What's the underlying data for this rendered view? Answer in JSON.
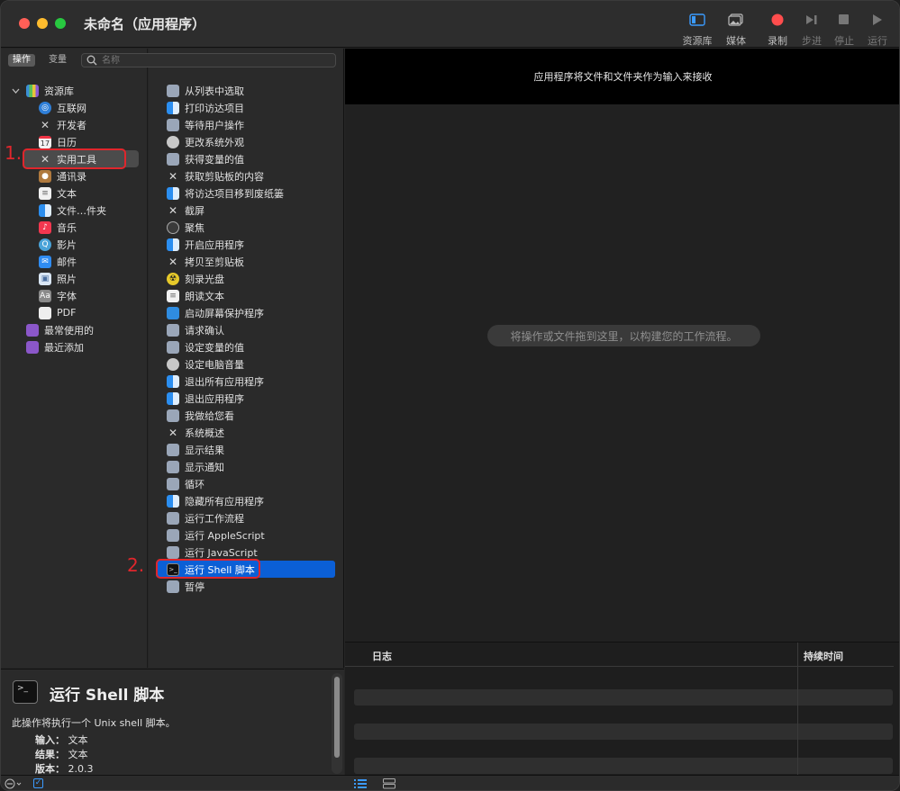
{
  "window": {
    "title": "未命名（应用程序）"
  },
  "toolbar": {
    "library_label": "资源库",
    "media_label": "媒体",
    "record_label": "录制",
    "step_label": "步进",
    "stop_label": "停止",
    "run_label": "运行",
    "colors": {
      "accent": "#3b9bff",
      "record": "#ff4d4d"
    }
  },
  "tabs": {
    "actions": "操作",
    "variables": "变量"
  },
  "search": {
    "placeholder": "名称",
    "value": ""
  },
  "library": {
    "root": "资源库",
    "items": [
      {
        "label": "互联网",
        "icon": "globe-icon"
      },
      {
        "label": "开发者",
        "icon": "tools-icon"
      },
      {
        "label": "日历",
        "icon": "calendar-icon"
      },
      {
        "label": "实用工具",
        "icon": "tools-icon"
      },
      {
        "label": "通讯录",
        "icon": "contacts-icon"
      },
      {
        "label": "文本",
        "icon": "text-icon"
      },
      {
        "label": "文件…件夹",
        "icon": "finder-icon"
      },
      {
        "label": "音乐",
        "icon": "music-icon"
      },
      {
        "label": "影片",
        "icon": "movie-icon"
      },
      {
        "label": "邮件",
        "icon": "mail-icon"
      },
      {
        "label": "照片",
        "icon": "photos-icon"
      },
      {
        "label": "字体",
        "icon": "font-icon"
      },
      {
        "label": "PDF",
        "icon": "pdf-icon"
      }
    ],
    "smart_groups": [
      {
        "label": "最常使用的",
        "icon": "smart-folder-icon"
      },
      {
        "label": "最近添加",
        "icon": "smart-folder-icon"
      }
    ]
  },
  "actions": [
    {
      "label": "从列表中选取",
      "icon": "automator-icon"
    },
    {
      "label": "打印访达项目",
      "icon": "finder-icon"
    },
    {
      "label": "等待用户操作",
      "icon": "automator-icon"
    },
    {
      "label": "更改系统外观",
      "icon": "system-icon"
    },
    {
      "label": "获得变量的值",
      "icon": "automator-icon"
    },
    {
      "label": "获取剪贴板的内容",
      "icon": "tools-icon"
    },
    {
      "label": "将访达项目移到废纸篓",
      "icon": "finder-icon"
    },
    {
      "label": "截屏",
      "icon": "tools-icon"
    },
    {
      "label": "聚焦",
      "icon": "spotlight-icon"
    },
    {
      "label": "开启应用程序",
      "icon": "finder-icon"
    },
    {
      "label": "拷贝至剪贴板",
      "icon": "tools-icon"
    },
    {
      "label": "刻录光盘",
      "icon": "burn-icon"
    },
    {
      "label": "朗读文本",
      "icon": "text-icon"
    },
    {
      "label": "启动屏幕保护程序",
      "icon": "screensaver-icon"
    },
    {
      "label": "请求确认",
      "icon": "automator-icon"
    },
    {
      "label": "设定变量的值",
      "icon": "automator-icon"
    },
    {
      "label": "设定电脑音量",
      "icon": "system-icon"
    },
    {
      "label": "退出所有应用程序",
      "icon": "finder-icon"
    },
    {
      "label": "退出应用程序",
      "icon": "finder-icon"
    },
    {
      "label": "我做给您看",
      "icon": "automator-icon"
    },
    {
      "label": "系统概述",
      "icon": "tools-icon"
    },
    {
      "label": "显示结果",
      "icon": "automator-icon"
    },
    {
      "label": "显示通知",
      "icon": "automator-icon"
    },
    {
      "label": "循环",
      "icon": "automator-icon"
    },
    {
      "label": "隐藏所有应用程序",
      "icon": "finder-icon"
    },
    {
      "label": "运行工作流程",
      "icon": "automator-icon"
    },
    {
      "label": "运行 AppleScript",
      "icon": "automator-icon"
    },
    {
      "label": "运行 JavaScript",
      "icon": "automator-icon"
    },
    {
      "label": "运行 Shell 脚本",
      "icon": "terminal-icon"
    },
    {
      "label": "暂停",
      "icon": "automator-icon"
    }
  ],
  "annotations": {
    "step1": "1.",
    "step2": "2."
  },
  "description": {
    "title": "运行 Shell 脚本",
    "text": "此操作将执行一个 Unix shell 脚本。",
    "input_label": "输入：",
    "input_value": "文本",
    "result_label": "结果：",
    "result_value": "文本",
    "version_label": "版本：",
    "version_value": "2.0.3"
  },
  "workflow": {
    "header": "应用程序将文件和文件夹作为输入来接收",
    "drop_hint": "将操作或文件拖到这里，以构建您的工作流程。"
  },
  "log": {
    "col_log": "日志",
    "col_duration": "持续时间"
  }
}
